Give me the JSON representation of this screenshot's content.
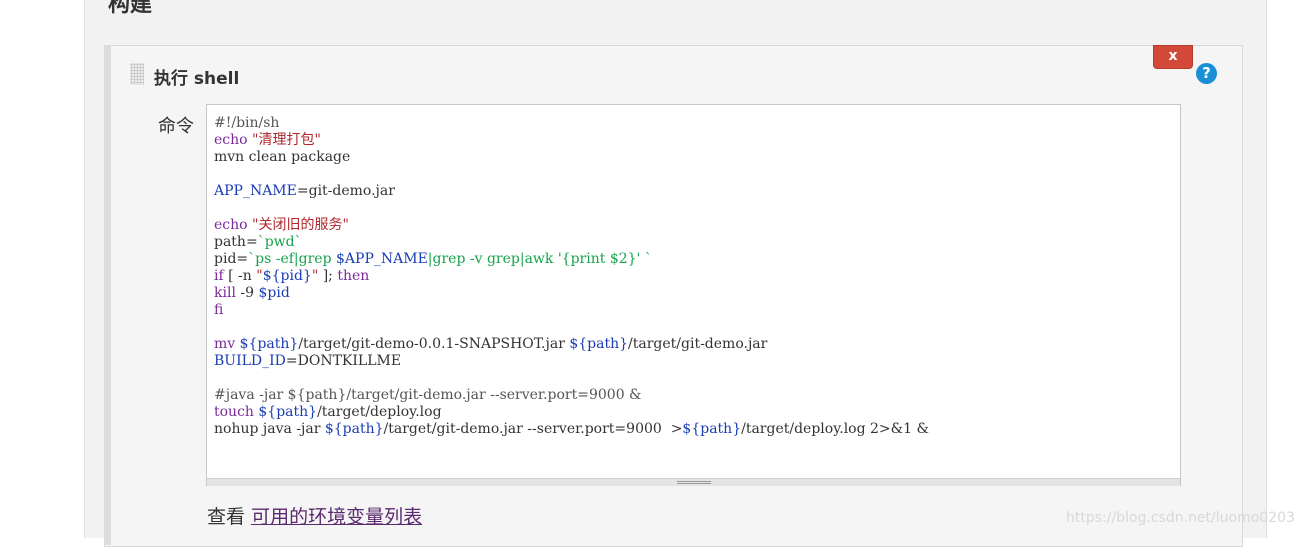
{
  "section": {
    "title": "构建"
  },
  "step": {
    "title": "执行 shell",
    "delete_label": "x",
    "help_label": "?"
  },
  "command": {
    "label": "命令",
    "lines": [
      "#!/bin/sh",
      "echo \"清理打包\"",
      "mvn clean package",
      "",
      "APP_NAME=git-demo.jar",
      "",
      "echo \"关闭旧的服务\"",
      "path=`pwd`",
      "pid=`ps -ef|grep $APP_NAME|grep -v grep|awk '{print $2}' `",
      "if [ -n \"${pid}\" ]; then",
      "kill -9 $pid",
      "fi",
      "",
      "mv ${path}/target/git-demo-0.0.1-SNAPSHOT.jar ${path}/target/git-demo.jar",
      "BUILD_ID=DONTKILLME",
      "",
      "#java -jar ${path}/target/git-demo.jar --server.port=9000 &",
      "touch ${path}/target/deploy.log",
      "nohup java -jar ${path}/target/git-demo.jar --server.port=9000  >${path}/target/deploy.log 2>&1 &"
    ]
  },
  "footer": {
    "prefix": "查看",
    "link_text": "可用的环境变量列表"
  },
  "watermark": "https://blog.csdn.net/luomo0203"
}
